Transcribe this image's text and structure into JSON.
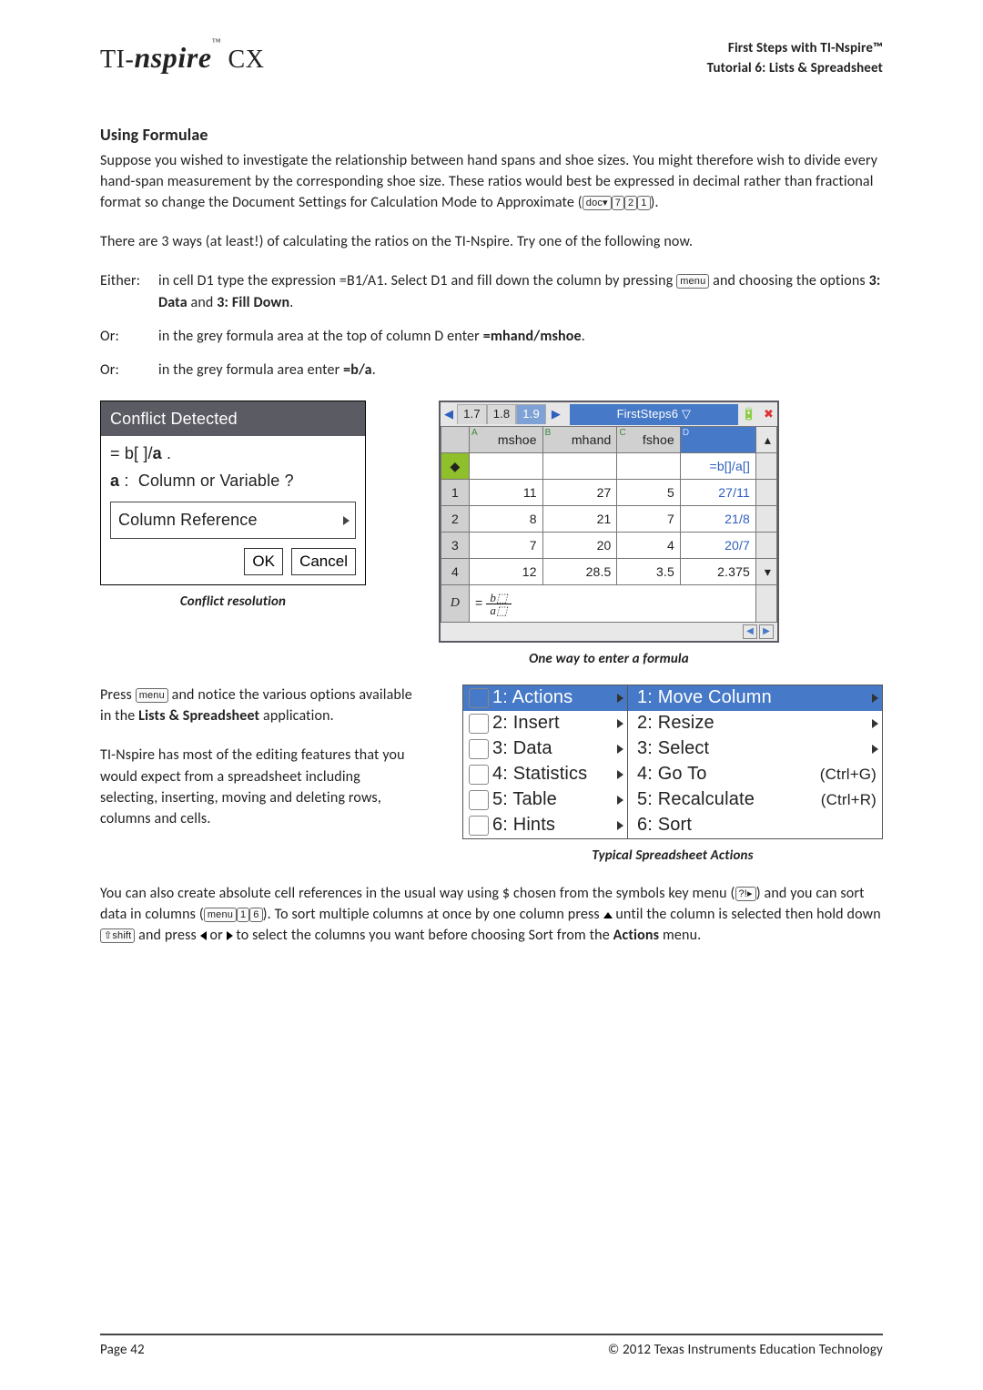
{
  "header": {
    "brand_prefix": "TI-",
    "brand_name": "nspire",
    "brand_suffix": " CX",
    "right_line1": "First Steps with TI-Nspire™",
    "right_line2": "Tutorial 6: Lists & Spreadsheet"
  },
  "section_title": "Using Formulae",
  "p1": "Suppose you wished to investigate the relationship between hand spans and shoe sizes. You might therefore wish to divide every hand-span measurement by the corresponding shoe size. These ratios would best be expressed in decimal rather than fractional format so change the Document Settings for Calculation Mode to Approximate (",
  "p1_keys": [
    "doc▾",
    "7",
    "2",
    "1"
  ],
  "p1_end": ").",
  "p2": "There are 3 ways (at least!) of calculating the ratios on the TI-Nspire. Try one of the following now.",
  "methods": {
    "either": {
      "label": "Either:",
      "text_a": "in cell D1 type the expression =B1/A1. Select D1 and fill down the column by pressing ",
      "key": "menu",
      "text_b": " and choosing the options ",
      "bold1": "3: Data",
      "and": " and ",
      "bold2": "3: Fill Down",
      "end": "."
    },
    "or1": {
      "label": "Or:",
      "text": "in the grey formula area at the top of column D enter ",
      "bold": "=mhand/mshoe",
      "end": "."
    },
    "or2": {
      "label": "Or:",
      "text": "in the grey formula area enter ",
      "bold": "=b/a",
      "end": "."
    }
  },
  "conflict": {
    "title": "Conflict Detected",
    "expr": "=b[]/a.",
    "question": "a :   Column or Variable ?",
    "option": "Column Reference",
    "ok": "OK",
    "cancel": "Cancel",
    "caption": "Conflict resolution"
  },
  "sheet": {
    "tabs": [
      "1.7",
      "1.8",
      "1.9"
    ],
    "filename": "FirstSteps6",
    "cols": [
      {
        "lbl": "A",
        "name": "mshoe"
      },
      {
        "lbl": "B",
        "name": "mhand"
      },
      {
        "lbl": "C",
        "name": "fshoe"
      },
      {
        "lbl": "D",
        "name": ""
      }
    ],
    "dformula": "=b[]/a[]",
    "rows": [
      {
        "n": "1",
        "a": "11",
        "b": "27",
        "c": "5",
        "d": "27/11"
      },
      {
        "n": "2",
        "a": "8",
        "b": "21",
        "c": "7",
        "d": "21/8"
      },
      {
        "n": "3",
        "a": "7",
        "b": "20",
        "c": "4",
        "d": "20/7"
      },
      {
        "n": "4",
        "a": "12",
        "b": "28.5",
        "c": "3.5",
        "d": "2.375"
      }
    ],
    "editrow": {
      "label": "D",
      "eq": "=",
      "num": "b",
      "den": "a"
    },
    "caption": "One way to enter a formula"
  },
  "after": {
    "t1a": "Press ",
    "t1key": "menu",
    "t1b": " and notice the various options available in the ",
    "t1bold": "Lists & Spreadsheet",
    "t1c": " application.",
    "t2": "TI-Nspire has most of the editing features that you would expect from a spreadsheet including selecting, inserting, moving and deleting rows, columns and cells."
  },
  "menuimg": {
    "left": [
      {
        "n": "1",
        "label": "Actions",
        "hl": true
      },
      {
        "n": "2",
        "label": "Insert"
      },
      {
        "n": "3",
        "label": "Data"
      },
      {
        "n": "4",
        "label": "Statistics"
      },
      {
        "n": "5",
        "label": "Table"
      },
      {
        "n": "6",
        "label": "Hints"
      }
    ],
    "right": [
      {
        "n": "1",
        "label": "Move Column",
        "hl": true,
        "sc": ""
      },
      {
        "n": "2",
        "label": "Resize",
        "sc": ""
      },
      {
        "n": "3",
        "label": "Select",
        "sc": ""
      },
      {
        "n": "4",
        "label": "Go To",
        "sc": "(Ctrl+G)"
      },
      {
        "n": "5",
        "label": "Recalculate",
        "sc": "(Ctrl+R)"
      },
      {
        "n": "6",
        "label": "Sort",
        "sc": ""
      }
    ],
    "caption": "Typical Spreadsheet Actions"
  },
  "p3": {
    "a": "You can also create absolute cell references in the usual way using $ chosen from the symbols key menu (",
    "k1": "?!▸",
    "b": ") and you can sort data in columns (",
    "k2": [
      "menu",
      "1",
      "6"
    ],
    "c": ").  To sort multiple columns at once by one column press ",
    "d": " until the column is selected then hold down ",
    "k3": "⇧shift",
    "e": " and press ",
    "f": " or ",
    "g": " to select the columns you want before choosing Sort from the ",
    "bold": "Actions",
    "h": " menu."
  },
  "footer": {
    "left": "Page  42",
    "right": "© 2012 Texas Instruments Education Technology"
  }
}
